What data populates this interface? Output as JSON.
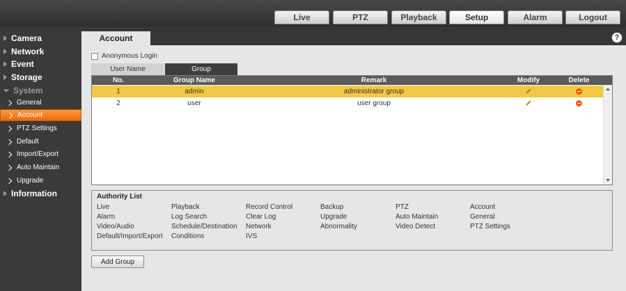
{
  "topnav": {
    "tabs": [
      "Live",
      "PTZ",
      "Playback",
      "Setup",
      "Alarm",
      "Logout"
    ],
    "active": "Setup"
  },
  "sidebar": {
    "sections": [
      "Camera",
      "Network",
      "Event",
      "Storage",
      "System",
      "Information"
    ],
    "open_section": "System",
    "system_items": [
      "General",
      "Account",
      "PTZ Settings",
      "Default",
      "Import/Export",
      "Auto Maintain",
      "Upgrade"
    ],
    "active_item": "Account"
  },
  "page": {
    "title": "Account",
    "anonymous_login_label": "Anonymous Login",
    "anonymous_login_checked": false,
    "subtabs": [
      "User Name",
      "Group"
    ],
    "active_subtab": "Group"
  },
  "table": {
    "headers": [
      "No.",
      "Group Name",
      "Remark",
      "Modify",
      "Delete"
    ],
    "rows": [
      {
        "no": "1",
        "group": "admin",
        "remark": "administrator group",
        "selected": true
      },
      {
        "no": "2",
        "group": "user",
        "remark": "user group",
        "selected": false
      }
    ]
  },
  "authority": {
    "title": "Authority List",
    "items": [
      "Live",
      "Playback",
      "Record Control",
      "Backup",
      "PTZ",
      "Account",
      "Alarm",
      "Log Search",
      "Clear Log",
      "Upgrade",
      "Auto Maintain",
      "General",
      "Video/Audio",
      "Schedule/Destination",
      "Network",
      "Abnormality",
      "Video Detect",
      "PTZ Settings",
      "Default/Import/Export",
      "Conditions",
      "IVS"
    ]
  },
  "buttons": {
    "add_group": "Add Group"
  },
  "colors": {
    "accent": "#f07a1a",
    "selected_row": "#f2c844",
    "header": "#5a5a5a"
  }
}
